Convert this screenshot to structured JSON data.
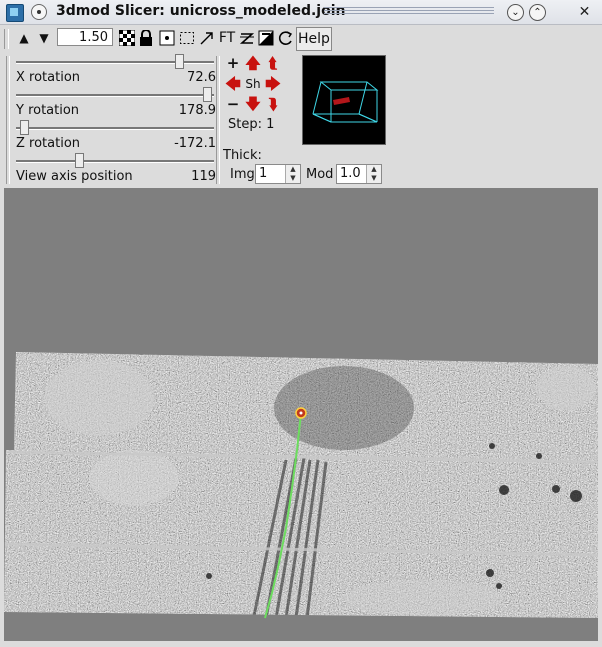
{
  "window": {
    "title": "3dmod Slicer: unicross_modeled.join",
    "icons": [
      "app-icon",
      "pin-icon",
      "minimize-icon",
      "maximize-icon",
      "close-icon"
    ]
  },
  "toolbar": {
    "zoom_value": "1.50",
    "ft_label": "FT",
    "help_label": "Help"
  },
  "sliders": [
    {
      "label": "X rotation",
      "value": "72.6",
      "level": 0.84
    },
    {
      "label": "Y rotation",
      "value": "178.9",
      "level": 0.99
    },
    {
      "label": "Z rotation",
      "value": "-172.1",
      "level": 0.02
    },
    {
      "label": "View axis position",
      "value": "119",
      "level": 0.31
    }
  ],
  "nav": {
    "shift_label": "Sh",
    "step_text": "Step: 1"
  },
  "thickness": {
    "label": "Thick:",
    "img_label": "Img",
    "img_value": "1",
    "mod_label": "Mod",
    "mod_value": "1.0"
  },
  "colors": {
    "title_bg": "#e6e8ec",
    "panel_bg": "#dcdcdc",
    "view_bg": "#7f7f7f",
    "arrow_red": "#c8120f",
    "bbox_cyan": "#3fd6e6",
    "model_line": "#6cdc5e",
    "model_point": "#c23a1e"
  }
}
